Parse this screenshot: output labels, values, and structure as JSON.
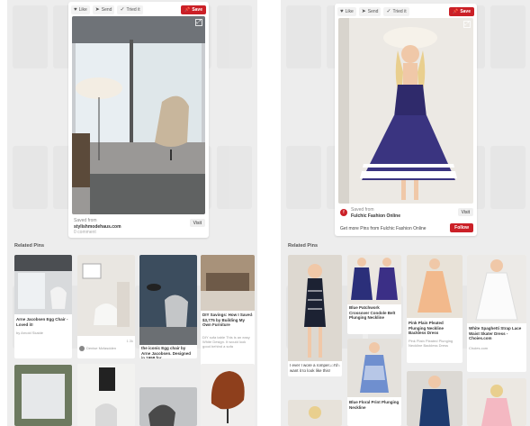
{
  "left": {
    "toolbar": {
      "like": "Like",
      "send": "Send",
      "tried": "Tried it",
      "save": "Save"
    },
    "saved_from": "Saved from",
    "source": "stylishmodehaus.com",
    "visit": "Visit",
    "comment": "0 comment",
    "related_title": "Related Pins",
    "pins": [
      {
        "caption": "Arne Jacobsen Egg Chair - Loved it!",
        "sub": "by Arnold Skalde",
        "count": ""
      },
      {
        "caption": "",
        "sub": "Denise Mcfasdden",
        "count": "1.3k"
      },
      {
        "caption": "",
        "sub": "",
        "count": ""
      },
      {
        "caption": "DIY Savings: How I Saved $3,775 by Building My Own Furniture",
        "sub": "DIY sofa table This is an easy White Design. It would look good behind a sofa",
        "count": "4.7k"
      },
      {
        "caption": "",
        "sub": "",
        "count": ""
      },
      {
        "caption": "the iconic Egg chair by Arne Jacobsen. Designed in 1958 for...",
        "sub": "Office designs",
        "count": "4.1k"
      },
      {
        "caption": "",
        "sub": "",
        "count": ""
      },
      {
        "caption": "",
        "sub": "",
        "count": ""
      }
    ]
  },
  "right": {
    "toolbar": {
      "like": "Like",
      "send": "Send",
      "tried": "Tried it",
      "save": "Save"
    },
    "saved_from": "Saved from",
    "source": "Fulchic Fashion Online",
    "visit": "Visit",
    "more": "Get more Pins from Fulchic Fashion Online",
    "follow": "Follow",
    "related_title": "Related Pins",
    "pins": [
      {
        "caption": "Blue Patchwork Crossover Condole Belt Plunging Neckline",
        "sub": "Fulchic Fashion",
        "count": ""
      },
      {
        "caption": "Pink Plain Pleated Plunging Neckline Backless Dress",
        "sub": "Pink Plain Pleated Plunging Neckline Backless Dress",
        "count": ""
      },
      {
        "caption": "White Spaghetti Strap Lace Waist Skater Dress - Choies.com",
        "sub": "Choies.com",
        "count": ""
      },
      {
        "caption": "I ever I wore a romper... I'd want it to look like this!",
        "sub": "Jessica Rowe",
        "count": "102.7k"
      },
      {
        "caption": "Blue Floral Print Plunging Neckline",
        "sub": "Blue Floral Print Plunging Neckline",
        "count": ""
      },
      {
        "caption": "",
        "sub": "",
        "count": ""
      },
      {
        "caption": "",
        "sub": "",
        "count": ""
      }
    ]
  },
  "colors": {
    "red": "#cb2027",
    "bg": "#ededed"
  }
}
